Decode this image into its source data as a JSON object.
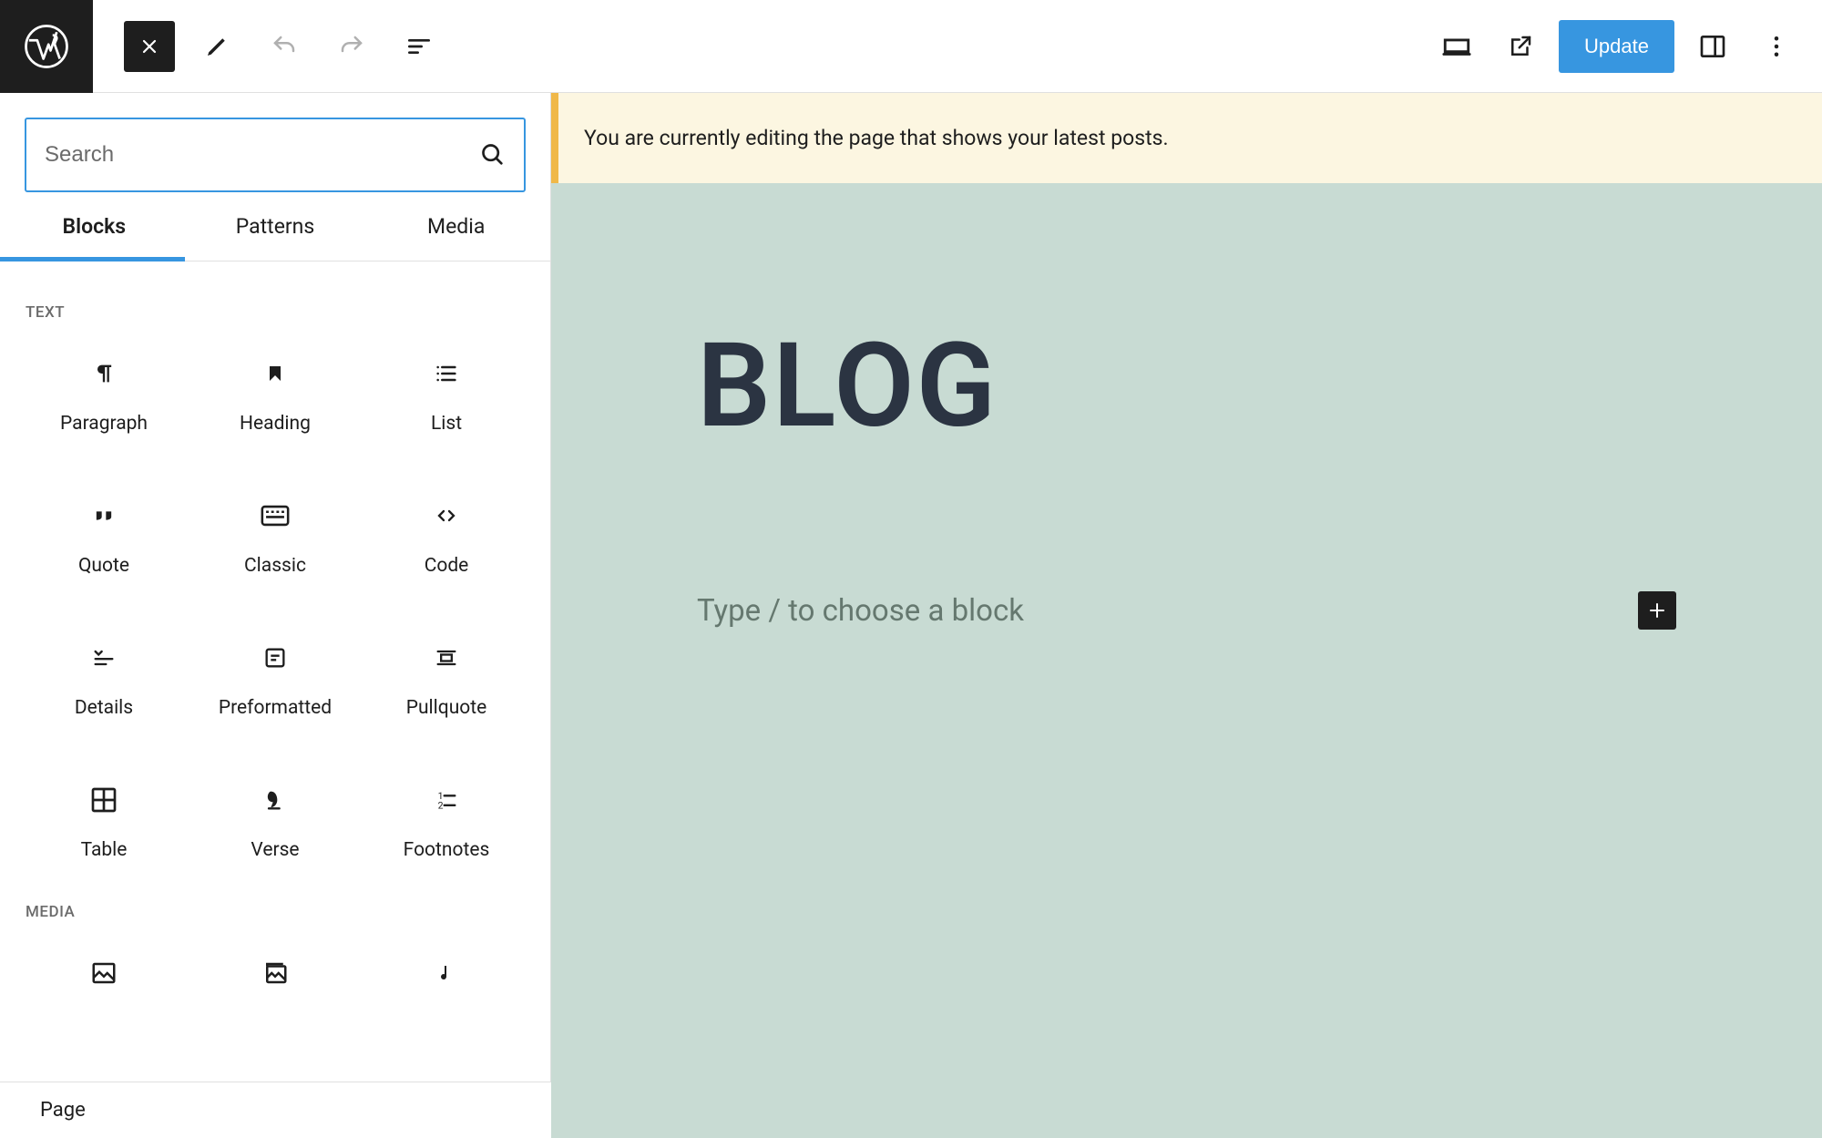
{
  "toolbar": {
    "update_label": "Update"
  },
  "sidebar": {
    "search_placeholder": "Search",
    "tabs": {
      "blocks": "Blocks",
      "patterns": "Patterns",
      "media": "Media"
    },
    "sections": {
      "text": {
        "label": "TEXT",
        "blocks": [
          "Paragraph",
          "Heading",
          "List",
          "Quote",
          "Classic",
          "Code",
          "Details",
          "Preformatted",
          "Pullquote",
          "Table",
          "Verse",
          "Footnotes"
        ]
      },
      "media": {
        "label": "MEDIA"
      }
    }
  },
  "notice": "You are currently editing the page that shows your latest posts.",
  "canvas": {
    "title": "BLOG",
    "block_prompt": "Type / to choose a block"
  },
  "footer": {
    "breadcrumb": "Page"
  },
  "colors": {
    "accent": "#3796e0",
    "dark": "#1e1e1e",
    "canvas_bg": "#c8dbd3",
    "notice_bg": "#fcf6e1",
    "notice_border": "#f0b849"
  }
}
